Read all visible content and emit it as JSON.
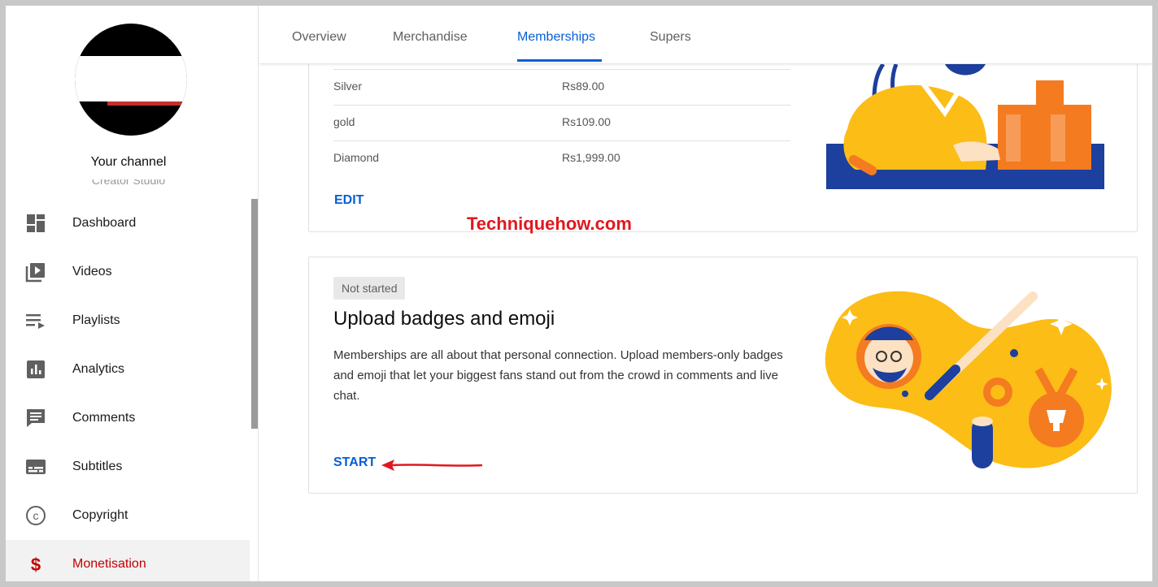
{
  "sidebar": {
    "channel_name": "Your channel",
    "channel_sub": "Creator Studio",
    "items": [
      {
        "label": "Dashboard",
        "icon": "dashboard-icon"
      },
      {
        "label": "Videos",
        "icon": "videos-icon"
      },
      {
        "label": "Playlists",
        "icon": "playlists-icon"
      },
      {
        "label": "Analytics",
        "icon": "analytics-icon"
      },
      {
        "label": "Comments",
        "icon": "comments-icon"
      },
      {
        "label": "Subtitles",
        "icon": "subtitles-icon"
      },
      {
        "label": "Copyright",
        "icon": "copyright-icon"
      },
      {
        "label": "Monetisation",
        "icon": "dollar-icon",
        "active": true
      }
    ]
  },
  "tabs": [
    {
      "label": "Overview"
    },
    {
      "label": "Merchandise"
    },
    {
      "label": "Memberships",
      "active": true
    },
    {
      "label": "Supers"
    }
  ],
  "tiers_card": {
    "rows": [
      {
        "name": "Silver",
        "price": "Rs89.00"
      },
      {
        "name": "gold",
        "price": "Rs109.00"
      },
      {
        "name": "Diamond",
        "price": "Rs1,999.00"
      }
    ],
    "edit_label": "EDIT"
  },
  "watermark": "Techniquehow.com",
  "badges_card": {
    "status": "Not started",
    "title": "Upload badges and emoji",
    "description": "Memberships are all about that personal connection. Upload members-only badges and emoji that let your biggest fans stand out from the crowd in comments and live chat.",
    "start_label": "START"
  },
  "colors": {
    "accent_blue": "#065fd4",
    "active_red": "#c40000",
    "watermark_red": "#e0181e",
    "illustration_yellow": "#fbbd16",
    "illustration_orange": "#f47b20",
    "illustration_navy": "#1d3f9e"
  }
}
